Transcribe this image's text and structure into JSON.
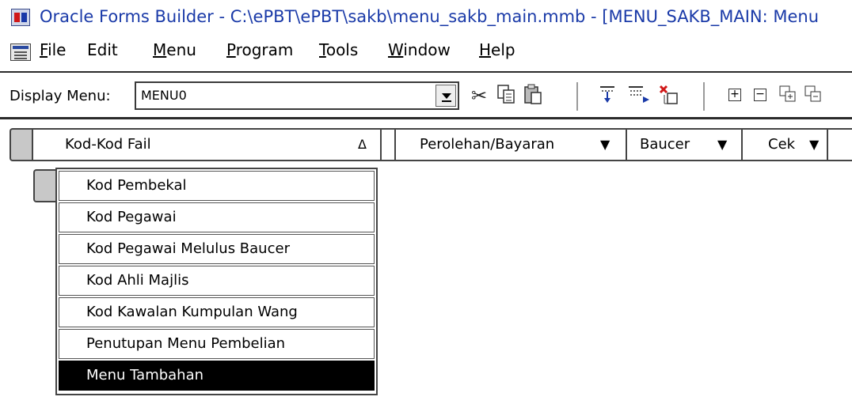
{
  "window": {
    "title": "Oracle Forms Builder - C:\\ePBT\\ePBT\\sakb\\menu_sakb_main.mmb - [MENU_SAKB_MAIN: Menu"
  },
  "menubar": {
    "items": [
      {
        "label": "File",
        "underline": "F",
        "rest": "ile"
      },
      {
        "label": "Edit",
        "underline": "",
        "rest": "Edit"
      },
      {
        "label": "Menu",
        "underline": "M",
        "rest": "enu"
      },
      {
        "label": "Program",
        "underline": "P",
        "rest": "rogram"
      },
      {
        "label": "Tools",
        "underline": "T",
        "rest": "ools"
      },
      {
        "label": "Window",
        "underline": "W",
        "rest": "indow"
      },
      {
        "label": "Help",
        "underline": "H",
        "rest": "elp"
      }
    ]
  },
  "toolbar": {
    "display_label": "Display Menu:",
    "display_value": "MENU0",
    "icons": [
      "cut-icon",
      "copy-icon",
      "paste-icon",
      "create-down-icon",
      "create-right-icon",
      "delete-icon",
      "expand-icon",
      "collapse-icon",
      "expand-all-icon",
      "collapse-all-icon"
    ]
  },
  "header": {
    "columns": [
      {
        "label": "Kod-Kod Fail",
        "marker": "Δ"
      },
      {
        "label": "Perolehan/Bayaran",
        "marker": "▼"
      },
      {
        "label": "Baucer",
        "marker": "▼"
      },
      {
        "label": "Cek",
        "marker": "▼"
      }
    ]
  },
  "submenu": {
    "items": [
      "Kod Pembekal",
      "Kod Pegawai",
      "Kod Pegawai Melulus Baucer",
      "Kod Ahli Majlis",
      "Kod Kawalan Kumpulan Wang",
      "Penutupan Menu Pembelian",
      "Menu Tambahan"
    ],
    "selected_index": 6
  }
}
